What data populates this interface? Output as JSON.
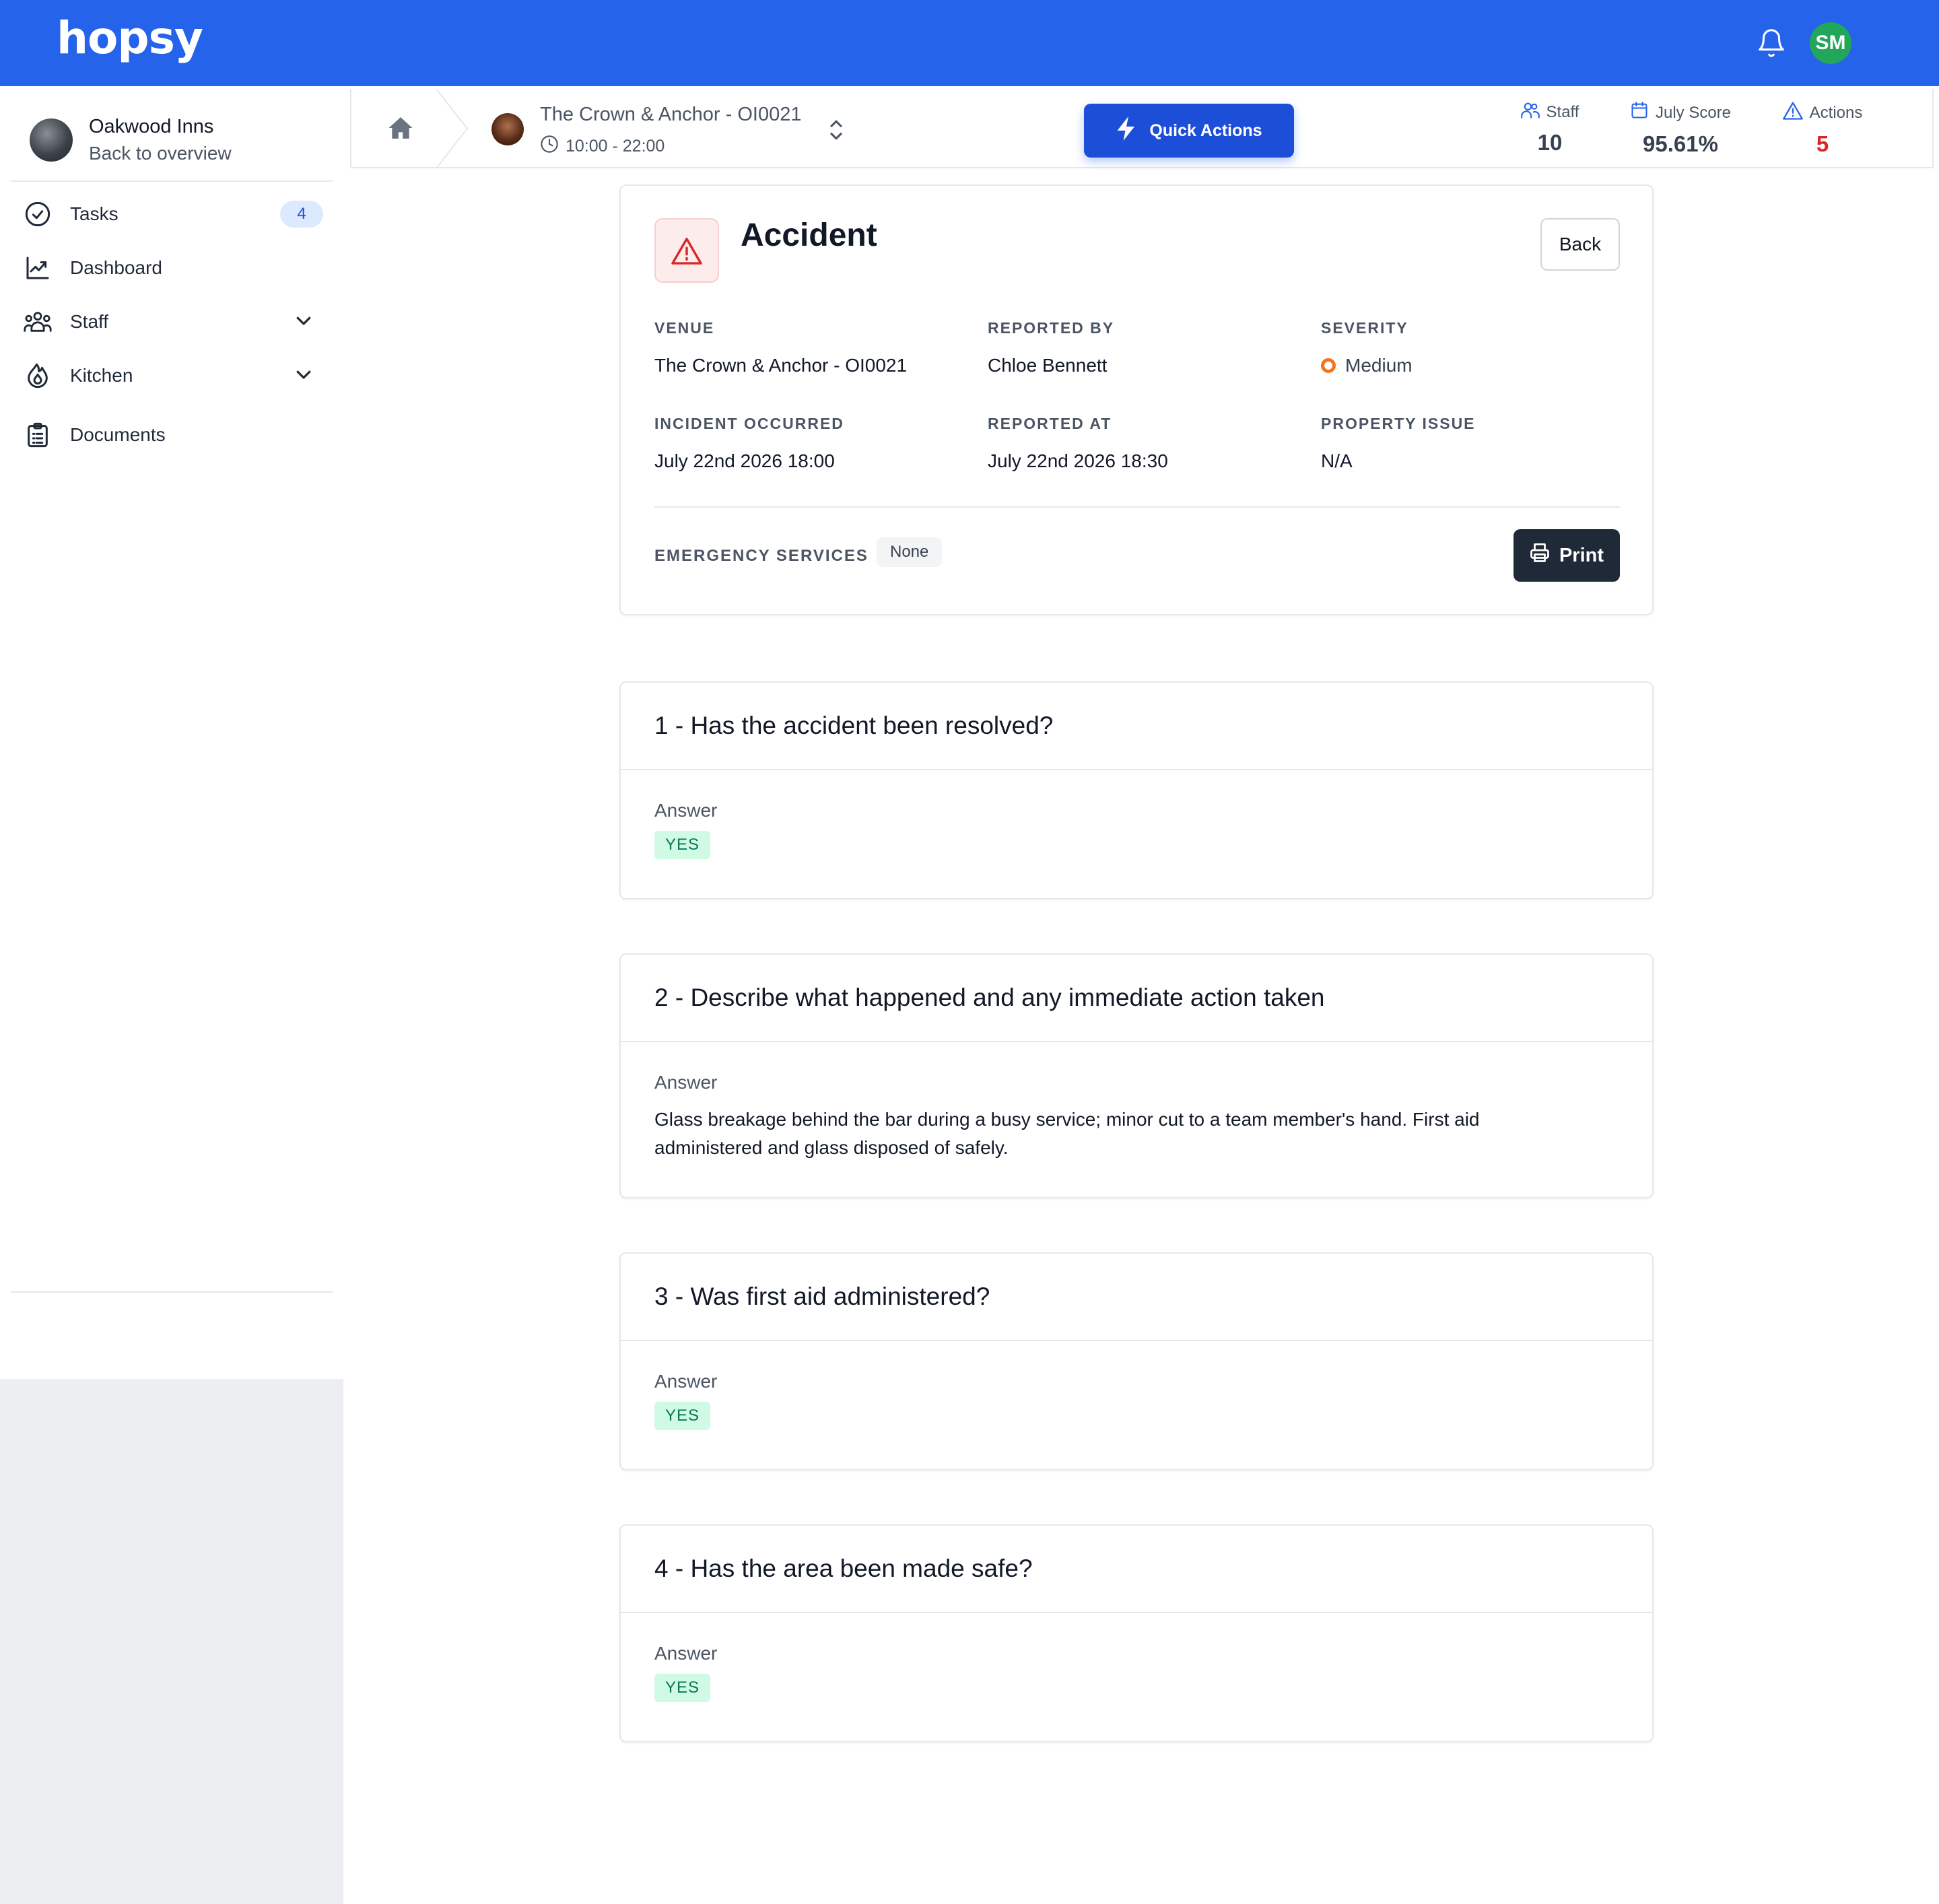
{
  "app": {
    "logo": "hopsy",
    "user_initials": "SM",
    "colors": {
      "brand": "#2563eb",
      "avatar": "#22a65a",
      "danger": "#dc2626",
      "severity_medium": "#f97316",
      "success_bg": "#d1fae5"
    }
  },
  "sidebar": {
    "org_name": "Oakwood Inns",
    "org_back": "Back to overview",
    "items": [
      {
        "label": "Tasks",
        "icon": "check-circle-icon",
        "badge": "4"
      },
      {
        "label": "Dashboard",
        "icon": "chart-line-icon"
      },
      {
        "label": "Staff",
        "icon": "users-icon",
        "expandable": true
      },
      {
        "label": "Kitchen",
        "icon": "flame-icon",
        "expandable": true
      },
      {
        "label": "Documents",
        "icon": "clipboard-icon"
      }
    ]
  },
  "header": {
    "venue_name": "The Crown & Anchor - OI0021",
    "venue_hours": "10:00 - 22:00",
    "quick_actions_label": "Quick Actions",
    "stats": [
      {
        "label": "Staff",
        "value": "10",
        "icon": "users-icon"
      },
      {
        "label": "July Score",
        "value": "95.61%",
        "icon": "calendar-icon"
      },
      {
        "label": "Actions",
        "value": "5",
        "icon": "warning-icon"
      }
    ]
  },
  "incident": {
    "title": "Accident",
    "back_label": "Back",
    "fields": {
      "venue": {
        "label": "VENUE",
        "value": "The Crown & Anchor - OI0021"
      },
      "reported_by": {
        "label": "REPORTED BY",
        "value": "Chloe Bennett"
      },
      "severity": {
        "label": "SEVERITY",
        "value": "Medium"
      },
      "occurred": {
        "label": "INCIDENT OCCURRED",
        "value": "July 22nd 2026 18:00"
      },
      "reported_at": {
        "label": "REPORTED AT",
        "value": "July 22nd 2026 18:30"
      },
      "property_issue": {
        "label": "PROPERTY ISSUE",
        "value": "N/A"
      }
    },
    "emergency_label": "EMERGENCY SERVICES",
    "emergency_value": "None",
    "print_label": "Print"
  },
  "questions": [
    {
      "title": "1 - Has the accident been resolved?",
      "answer_label": "Answer",
      "answer": "YES"
    },
    {
      "title": "2 - Describe what happened and any immediate action taken",
      "answer_label": "Answer",
      "answer": "Glass breakage behind the bar during a busy service; minor cut to a team member's hand. First aid administered and glass disposed of safely."
    },
    {
      "title": "3 - Was first aid administered?",
      "answer_label": "Answer",
      "answer": "YES"
    },
    {
      "title": "4 - Has the area been made safe?",
      "answer_label": "Answer",
      "answer": "YES"
    }
  ]
}
